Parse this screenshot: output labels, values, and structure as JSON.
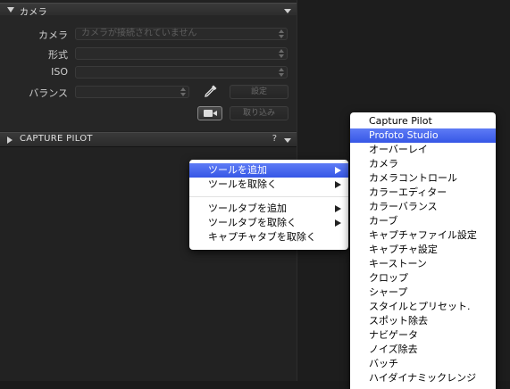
{
  "camera_section": {
    "title": "カメラ",
    "fields": {
      "camera_label": "カメラ",
      "camera_placeholder": "カメラが接続されていません",
      "format_label": "形式",
      "iso_label": "ISO",
      "balance_label": "バランス"
    },
    "settings_button": "設定",
    "capture_button": "取り込み"
  },
  "capture_pilot_section": {
    "title": "CAPTURE PILOT",
    "help": "?"
  },
  "context_menu": {
    "items": [
      {
        "label": "ツールを追加",
        "submenu": true,
        "highlighted": true
      },
      {
        "label": "ツールを取除く",
        "submenu": true
      },
      {
        "label": "ツールタブを追加",
        "submenu": true
      },
      {
        "label": "ツールタブを取除く",
        "submenu": true
      },
      {
        "label": "キャプチャタブを取除く",
        "submenu": false
      }
    ]
  },
  "submenu": {
    "items": [
      "Capture Pilot",
      "Profoto Studio",
      "オーバーレイ",
      "カメラ",
      "カメラコントロール",
      "カラーエディター",
      "カラーバランス",
      "カーブ",
      "キャプチャファイル設定",
      "キャプチャ設定",
      "キーストーン",
      "クロップ",
      "シャープ",
      "スタイルとプリセット.",
      "スポット除去",
      "ナビゲータ",
      "ノイズ除去",
      "バッチ",
      "ハイダイナミックレンジ"
    ],
    "highlighted_index": 1
  },
  "colors": {
    "highlight": "#3d5ff0",
    "panel_bg": "#222222"
  }
}
